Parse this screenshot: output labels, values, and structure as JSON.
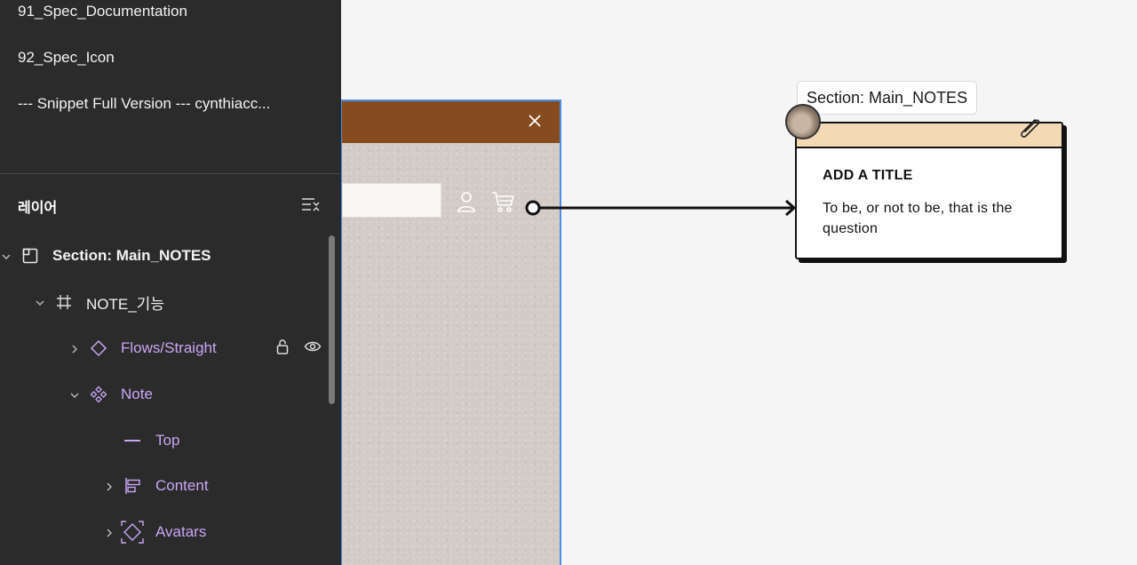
{
  "pages": [
    {
      "label": "91_Spec_Documentation"
    },
    {
      "label": "92_Spec_Icon"
    },
    {
      "label": "--- Snippet Full Version --- cynthiacc..."
    }
  ],
  "layers_panel": {
    "title": "레이어",
    "layers": [
      {
        "label": "Section: Main_NOTES",
        "icon": "section-icon",
        "expanded": true
      },
      {
        "label": "NOTE_기능",
        "icon": "frame-icon",
        "expanded": true
      },
      {
        "label": "Flows/Straight",
        "icon": "component-instance-icon",
        "expanded": false
      },
      {
        "label": "Note",
        "icon": "component-icon",
        "expanded": true
      },
      {
        "label": "Top",
        "icon": "line-icon"
      },
      {
        "label": "Content",
        "icon": "auto-layout-icon",
        "expanded": false
      },
      {
        "label": "Avatars",
        "icon": "avatars-frame-icon",
        "expanded": false
      }
    ]
  },
  "note": {
    "section_label": "Section: Main_NOTES",
    "title": "ADD A TITLE",
    "body": "To be, or not to be, that is the question"
  },
  "colors": {
    "sidebar_bg": "#2b2b2b",
    "component_purple": "#c9a6f5",
    "canvas_bg": "#f5f5f5",
    "frame_selection": "#4a8ee8",
    "banner_brown": "#864b1e",
    "note_header": "#f4dab4"
  }
}
